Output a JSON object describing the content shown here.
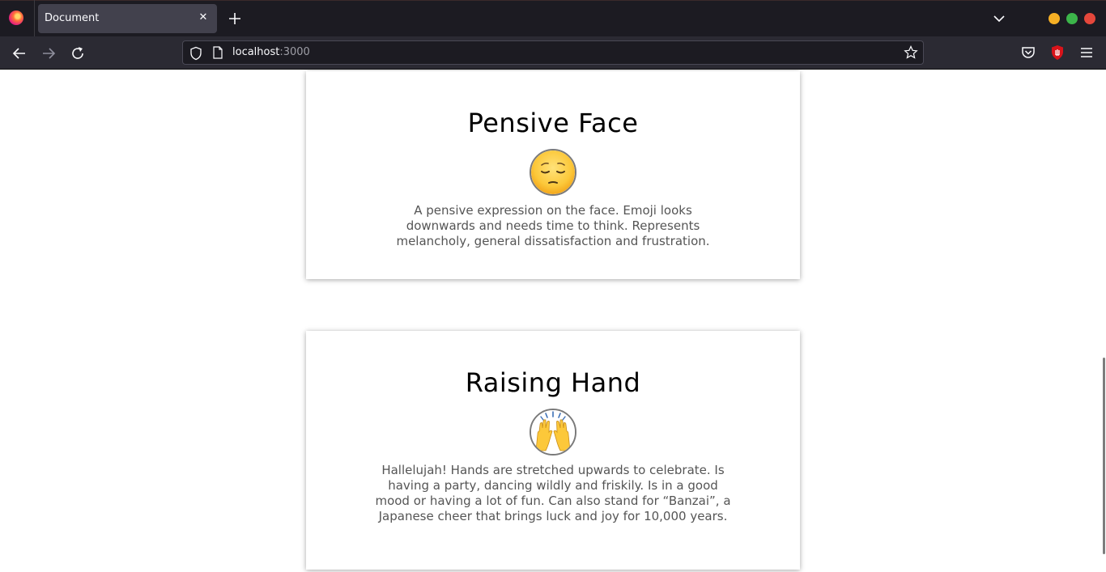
{
  "browser": {
    "tab_title": "Document",
    "url_host": "localhost",
    "url_port": ":3000"
  },
  "cards": [
    {
      "title": "Pensive Face",
      "emoji": "pensive-face",
      "description": "A pensive expression on the face. Emoji looks downwards and needs time to think. Represents melancholy, general dissatisfaction and frustration."
    },
    {
      "title": "Raising Hand",
      "emoji": "raising-hands",
      "description": "Hallelujah! Hands are stretched upwards to celebrate. Is having a party, dancing wildly and friskily. Is in a good mood or having a lot of fun. Can also stand for “Banzai”, a Japanese cheer that brings luck and joy for 10,000 years."
    }
  ],
  "colors": {
    "chrome_dark": "#1c1b22",
    "toolbar": "#2b2a33",
    "tab_active": "#42414d",
    "card_text": "#555555"
  }
}
